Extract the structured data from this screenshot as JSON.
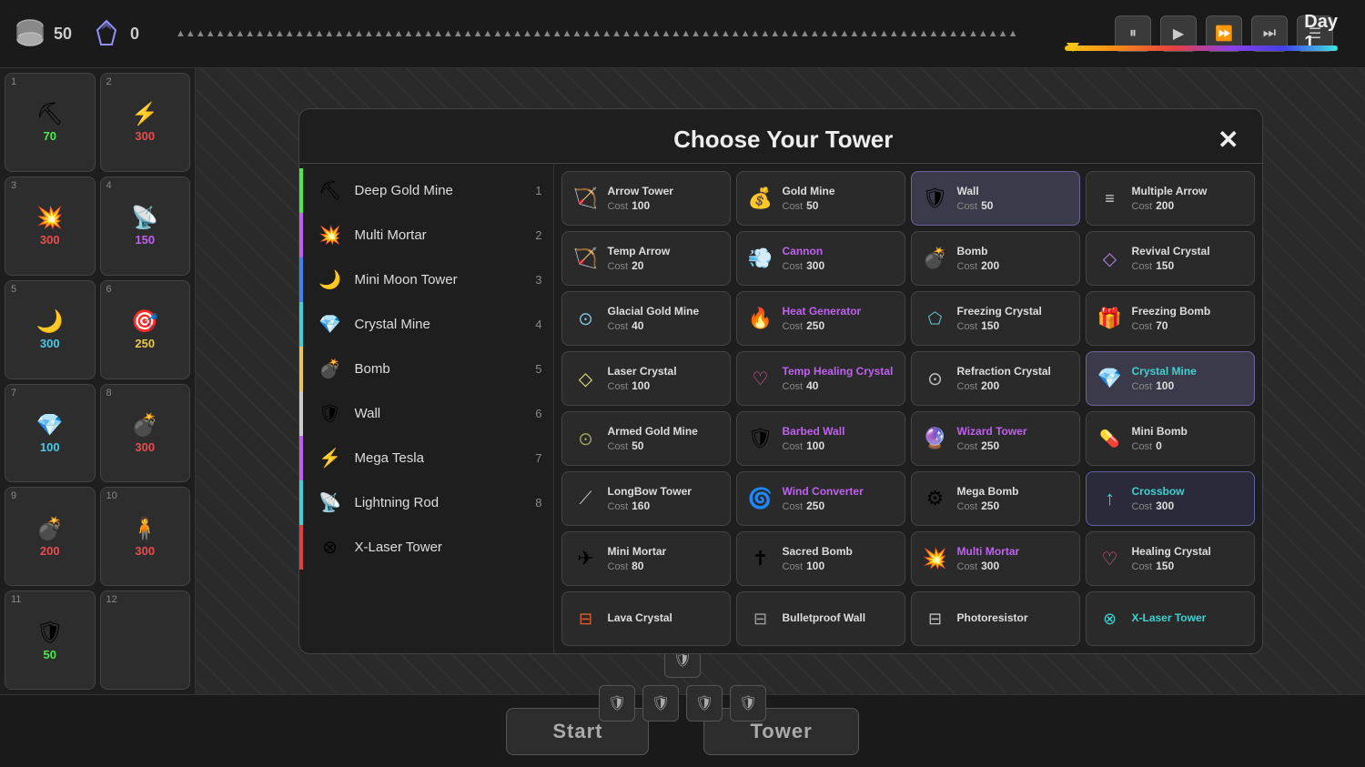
{
  "topbar": {
    "gold": "50",
    "crystal": "0",
    "day": "Day 1",
    "controls": [
      "⏸",
      "▶",
      "⏩",
      "⏭",
      "☰"
    ]
  },
  "sidebar": {
    "slots": [
      {
        "num": "1",
        "icon": "⛏",
        "cost": "70",
        "costClass": "cost-green"
      },
      {
        "num": "2",
        "icon": "⚡",
        "cost": "300",
        "costClass": "cost-red"
      },
      {
        "num": "3",
        "icon": "💥",
        "cost": "300",
        "costClass": "cost-red"
      },
      {
        "num": "4",
        "icon": "📡",
        "cost": "150",
        "costClass": "cost-purple"
      },
      {
        "num": "5",
        "icon": "🌙",
        "cost": "300",
        "costClass": "cost-cyan"
      },
      {
        "num": "6",
        "icon": "🎯",
        "cost": "250",
        "costClass": "cost-yellow"
      },
      {
        "num": "7",
        "icon": "💎",
        "cost": "100",
        "costClass": "cost-cyan"
      },
      {
        "num": "8",
        "icon": "💣",
        "cost": "300",
        "costClass": "cost-red"
      },
      {
        "num": "9",
        "icon": "💣",
        "cost": "200",
        "costClass": "cost-red"
      },
      {
        "num": "10",
        "icon": "🧍",
        "cost": "300",
        "costClass": "cost-red"
      },
      {
        "num": "11",
        "icon": "🛡",
        "cost": "50",
        "costClass": "cost-green"
      },
      {
        "num": "12",
        "icon": "",
        "cost": "",
        "costClass": ""
      }
    ]
  },
  "modal": {
    "title": "Choose Your Tower",
    "close_label": "✕",
    "list_items": [
      {
        "name": "Deep Gold Mine",
        "icon": "⛏",
        "num": "1",
        "borderClass": "border-green"
      },
      {
        "name": "Multi Mortar",
        "icon": "💥",
        "num": "2",
        "borderClass": "border-purple"
      },
      {
        "name": "Mini Moon Tower",
        "icon": "🌙",
        "num": "3",
        "borderClass": "border-blue"
      },
      {
        "name": "Crystal Mine",
        "icon": "💎",
        "num": "4",
        "borderClass": "border-cyan"
      },
      {
        "name": "Bomb",
        "icon": "💣",
        "num": "5",
        "borderClass": "border-yellow"
      },
      {
        "name": "Wall",
        "icon": "🛡",
        "num": "6",
        "borderClass": "border-white"
      },
      {
        "name": "Mega Tesla",
        "icon": "⚡",
        "num": "7",
        "borderClass": "border-purple"
      },
      {
        "name": "Lightning Rod",
        "icon": "📡",
        "num": "8",
        "borderClass": "border-cyan"
      },
      {
        "name": "X-Laser Tower",
        "icon": "⊗",
        "num": "",
        "borderClass": "border-red"
      }
    ],
    "grid_items": [
      {
        "name": "Arrow Tower",
        "icon": "🏹",
        "cost": "100",
        "nameClass": ""
      },
      {
        "name": "Gold Mine",
        "icon": "💰",
        "cost": "50",
        "nameClass": ""
      },
      {
        "name": "Wall",
        "icon": "🛡",
        "cost": "50",
        "nameClass": "",
        "selected": true
      },
      {
        "name": "Multiple Arrow",
        "icon": "≡",
        "cost": "200",
        "nameClass": ""
      },
      {
        "name": "Temp Arrow",
        "icon": "🏹",
        "cost": "20",
        "nameClass": ""
      },
      {
        "name": "Cannon",
        "icon": "💨",
        "cost": "300",
        "nameClass": "purple"
      },
      {
        "name": "Bomb",
        "icon": "💣",
        "cost": "200",
        "nameClass": ""
      },
      {
        "name": "Revival Crystal",
        "icon": "◇",
        "cost": "150",
        "nameClass": ""
      },
      {
        "name": "Glacial Gold Mine",
        "icon": "⊙",
        "cost": "40",
        "nameClass": ""
      },
      {
        "name": "Heat Generator",
        "icon": "🔥",
        "cost": "250",
        "nameClass": "purple"
      },
      {
        "name": "Freezing Crystal",
        "icon": "⬠",
        "cost": "150",
        "nameClass": ""
      },
      {
        "name": "Freezing Bomb",
        "icon": "🎁",
        "cost": "70",
        "nameClass": ""
      },
      {
        "name": "Laser Crystal",
        "icon": "◇",
        "cost": "100",
        "nameClass": ""
      },
      {
        "name": "Temp Healing Crystal",
        "icon": "♡",
        "cost": "40",
        "nameClass": "purple"
      },
      {
        "name": "Refraction Crystal",
        "icon": "⊙",
        "cost": "200",
        "nameClass": ""
      },
      {
        "name": "Crystal Mine",
        "icon": "💎",
        "cost": "100",
        "nameClass": "cyan",
        "selected": true
      },
      {
        "name": "Armed Gold Mine",
        "icon": "⊙",
        "cost": "50",
        "nameClass": ""
      },
      {
        "name": "Barbed Wall",
        "icon": "🛡",
        "cost": "100",
        "nameClass": "purple"
      },
      {
        "name": "Wizard Tower",
        "icon": "🔮",
        "cost": "250",
        "nameClass": "purple"
      },
      {
        "name": "Mini Bomb",
        "icon": "💊",
        "cost": "0",
        "nameClass": ""
      },
      {
        "name": "LongBow Tower",
        "icon": "⟋",
        "cost": "160",
        "nameClass": ""
      },
      {
        "name": "Wind Converter",
        "icon": "🌀",
        "cost": "250",
        "nameClass": "purple"
      },
      {
        "name": "Mega Bomb",
        "icon": "⚙",
        "cost": "250",
        "nameClass": ""
      },
      {
        "name": "Crossbow",
        "icon": "↑",
        "cost": "300",
        "nameClass": "cyan"
      },
      {
        "name": "Mini Mortar",
        "icon": "✈",
        "cost": "80",
        "nameClass": ""
      },
      {
        "name": "Sacred Bomb",
        "icon": "✝",
        "cost": "100",
        "nameClass": ""
      },
      {
        "name": "Multi Mortar",
        "icon": "💥",
        "cost": "300",
        "nameClass": "purple"
      },
      {
        "name": "Healing Crystal",
        "icon": "♡",
        "cost": "150",
        "nameClass": ""
      },
      {
        "name": "Lava Crystal",
        "icon": "⊟",
        "cost": "",
        "nameClass": ""
      },
      {
        "name": "Bulletproof Wall",
        "icon": "⊟",
        "cost": "",
        "nameClass": ""
      },
      {
        "name": "Photoresistor",
        "icon": "⊟",
        "cost": "",
        "nameClass": ""
      },
      {
        "name": "X-Laser Tower",
        "icon": "⊗",
        "cost": "",
        "nameClass": "cyan"
      }
    ]
  },
  "bottombar": {
    "start_label": "Start",
    "tower_label": "Tower"
  }
}
